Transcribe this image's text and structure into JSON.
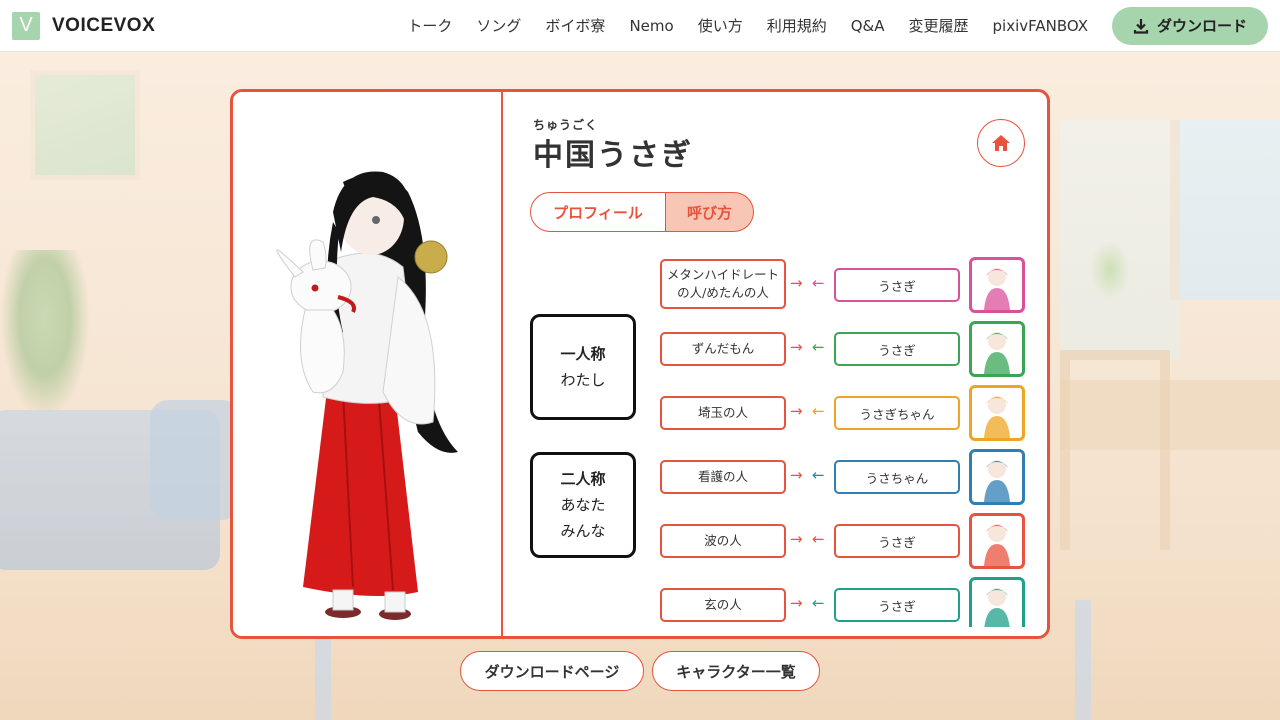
{
  "header": {
    "logo_letter": "V",
    "logo_text": "VOICEVOX",
    "nav": [
      "トーク",
      "ソング",
      "ボイボ寮",
      "Nemo",
      "使い方",
      "利用規約",
      "Q&A",
      "変更履歴",
      "pixivFANBOX"
    ],
    "download_label": "ダウンロード"
  },
  "character": {
    "ruby": "ちゅうごく",
    "name": "中国うさぎ"
  },
  "tabs": {
    "profile": "プロフィール",
    "calling": "呼び方"
  },
  "first_person": {
    "title": "一人称",
    "value": "わたし"
  },
  "second_person": {
    "title": "二人称",
    "value1": "あなた",
    "value2": "みんな"
  },
  "relations": [
    {
      "out": "メタンハイドレート\nの人/めたんの人",
      "in": "うさぎ",
      "color": "#d9519b",
      "avatar_icon": "metan-avatar-icon"
    },
    {
      "out": "ずんだもん",
      "in": "うさぎ",
      "color": "#3aa655",
      "avatar_icon": "zundamon-avatar-icon"
    },
    {
      "out": "埼玉の人",
      "in": "うさぎちゃん",
      "color": "#f0a424",
      "avatar_icon": "saitama-avatar-icon"
    },
    {
      "out": "看護の人",
      "in": "うさちゃん",
      "color": "#2f7fb4",
      "avatar_icon": "nurse-avatar-icon"
    },
    {
      "out": "波の人",
      "in": "うさぎ",
      "color": "#e8533e",
      "avatar_icon": "wave-avatar-icon"
    },
    {
      "out": "玄の人",
      "in": "うさぎ",
      "color": "#1fa08a",
      "avatar_icon": "gen-avatar-icon"
    }
  ],
  "bottom": {
    "download_page": "ダウンロードページ",
    "character_list": "キャラクター一覧"
  },
  "colors": {
    "accent": "#e8533e",
    "brand_green": "#a5d4ad"
  }
}
